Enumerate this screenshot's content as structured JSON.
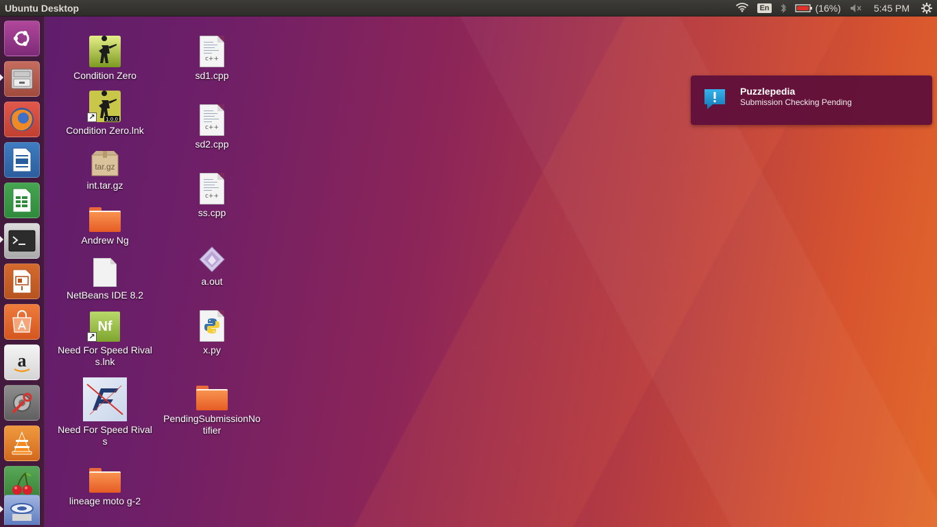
{
  "topbar": {
    "title": "Ubuntu Desktop",
    "keyboard_layout": "En",
    "battery_percent": "(16%)",
    "clock": "5:45 PM",
    "icons": [
      "wifi-icon",
      "keyboard-layout",
      "bluetooth-icon",
      "battery-icon",
      "volume-muted-icon",
      "session-gear-icon"
    ]
  },
  "launcher": {
    "items": [
      {
        "name": "ubuntu-dash",
        "icon": "ubuntu-logo-icon",
        "active": false
      },
      {
        "name": "files",
        "icon": "file-cabinet-icon",
        "active": true
      },
      {
        "name": "firefox",
        "icon": "firefox-icon",
        "active": false
      },
      {
        "name": "libreoffice-writer",
        "icon": "writer-icon",
        "active": false
      },
      {
        "name": "libreoffice-calc",
        "icon": "calc-icon",
        "active": false
      },
      {
        "name": "terminal",
        "icon": "terminal-icon",
        "active": true
      },
      {
        "name": "libreoffice-impress",
        "icon": "impress-icon",
        "active": false
      },
      {
        "name": "software-center",
        "icon": "shopping-bag-icon",
        "active": false
      },
      {
        "name": "amazon",
        "icon": "amazon-icon",
        "active": false
      },
      {
        "name": "system-settings",
        "icon": "settings-wrench-icon",
        "active": false
      },
      {
        "name": "vlc",
        "icon": "vlc-cone-icon",
        "active": false
      },
      {
        "name": "cherry-app",
        "icon": "cherry-icon",
        "active": false
      },
      {
        "name": "trash-drive",
        "icon": "drive-icon",
        "active": true
      }
    ]
  },
  "desktop": {
    "icons": [
      {
        "label": "Condition Zero",
        "type": "game"
      },
      {
        "label": "Condition Zero.lnk",
        "type": "game-link"
      },
      {
        "label": "int.tar.gz",
        "type": "archive",
        "badge": "tar.gz"
      },
      {
        "label": "Andrew Ng",
        "type": "folder"
      },
      {
        "label": "NetBeans IDE 8.2",
        "type": "document"
      },
      {
        "label": "Need For Speed Rivals.lnk",
        "type": "nfs-link",
        "badge": "Nf"
      },
      {
        "label": "Need For Speed Rivals",
        "type": "nfs"
      },
      {
        "label": "lineage moto g-2",
        "type": "folder"
      },
      {
        "label": "sd1.cpp",
        "type": "cpp",
        "badge": "c++"
      },
      {
        "label": "sd2.cpp",
        "type": "cpp",
        "badge": "c++"
      },
      {
        "label": "ss.cpp",
        "type": "cpp",
        "badge": "c++"
      },
      {
        "label": "a.out",
        "type": "executable"
      },
      {
        "label": "x.py",
        "type": "python"
      },
      {
        "label": "PendingSubmissionNotifier",
        "type": "folder"
      }
    ]
  },
  "notification": {
    "title": "Puzzlepedia",
    "body": "Submission Checking Pending",
    "icon": "exclamation-speech-icon"
  },
  "colors": {
    "panel_bg": "#2e2d2a",
    "notification_bg": "#5c0e3a",
    "folder_orange": "#f27b3c"
  }
}
